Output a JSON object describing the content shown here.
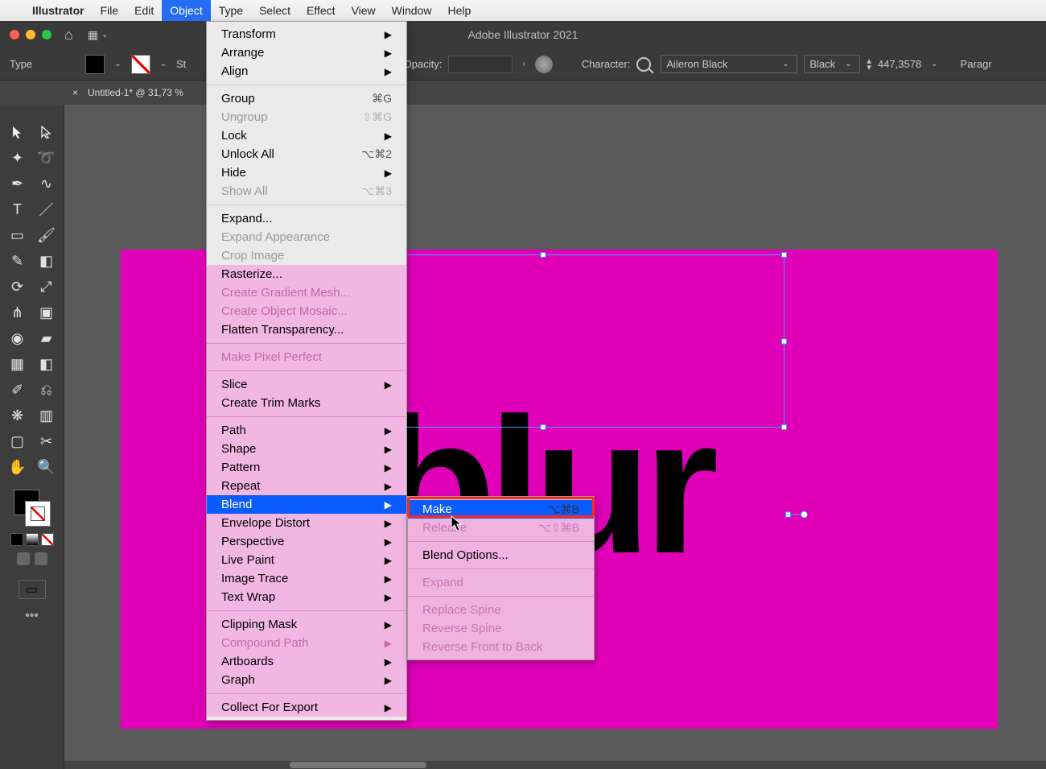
{
  "mac_menu": {
    "apple": "",
    "app": "Illustrator",
    "items": [
      "File",
      "Edit",
      "Object",
      "Type",
      "Select",
      "Effect",
      "View",
      "Window",
      "Help"
    ],
    "active": "Object"
  },
  "app": {
    "title": "Adobe Illustrator 2021"
  },
  "options_bar": {
    "type_label": "Type",
    "stroke_label": "St",
    "opacity_label": "Opacity:",
    "character_label": "Character:",
    "font_family": "Aileron Black",
    "font_style": "Black",
    "font_size": "447,3578",
    "right_label": "Paragr"
  },
  "document": {
    "tab": "Untitled-1* @ 31,73 %",
    "close": "×"
  },
  "canvas": {
    "text": "blur"
  },
  "object_menu_top": [
    {
      "label": "Transform",
      "arrow": true
    },
    {
      "label": "Arrange",
      "arrow": true
    },
    {
      "label": "Align",
      "arrow": true
    },
    {
      "sep": true
    },
    {
      "label": "Group",
      "shortcut": "⌘G"
    },
    {
      "label": "Ungroup",
      "shortcut": "⇧⌘G",
      "disabled": true
    },
    {
      "label": "Lock",
      "arrow": true
    },
    {
      "label": "Unlock All",
      "shortcut": "⌥⌘2"
    },
    {
      "label": "Hide",
      "arrow": true
    },
    {
      "label": "Show All",
      "shortcut": "⌥⌘3",
      "disabled": true
    },
    {
      "sep": true
    },
    {
      "label": "Expand..."
    },
    {
      "label": "Expand Appearance",
      "disabled": true
    },
    {
      "label": "Crop Image",
      "disabled": true
    }
  ],
  "object_menu_bottom": [
    {
      "label": "Rasterize..."
    },
    {
      "label": "Create Gradient Mesh...",
      "disabled": true
    },
    {
      "label": "Create Object Mosaic...",
      "disabled": true
    },
    {
      "label": "Flatten Transparency..."
    },
    {
      "sep": true
    },
    {
      "label": "Make Pixel Perfect",
      "disabled": true
    },
    {
      "sep": true
    },
    {
      "label": "Slice",
      "arrow": true
    },
    {
      "label": "Create Trim Marks"
    },
    {
      "sep": true
    },
    {
      "label": "Path",
      "arrow": true
    },
    {
      "label": "Shape",
      "arrow": true
    },
    {
      "label": "Pattern",
      "arrow": true
    },
    {
      "label": "Repeat",
      "arrow": true
    },
    {
      "label": "Blend",
      "arrow": true,
      "highlight": true
    },
    {
      "label": "Envelope Distort",
      "arrow": true
    },
    {
      "label": "Perspective",
      "arrow": true
    },
    {
      "label": "Live Paint",
      "arrow": true
    },
    {
      "label": "Image Trace",
      "arrow": true
    },
    {
      "label": "Text Wrap",
      "arrow": true
    },
    {
      "sep": true
    },
    {
      "label": "Clipping Mask",
      "arrow": true
    },
    {
      "label": "Compound Path",
      "arrow": true,
      "disabled": true
    },
    {
      "label": "Artboards",
      "arrow": true
    },
    {
      "label": "Graph",
      "arrow": true
    },
    {
      "sep": true
    },
    {
      "label": "Collect For Export",
      "arrow": true
    }
  ],
  "blend_submenu": [
    {
      "label": "Make",
      "shortcut": "⌥⌘B",
      "highlight": true
    },
    {
      "label": "Release",
      "shortcut": "⌥⇧⌘B",
      "disabled": true
    },
    {
      "sep": true
    },
    {
      "label": "Blend Options..."
    },
    {
      "sep": true
    },
    {
      "label": "Expand",
      "disabled": true
    },
    {
      "sep": true
    },
    {
      "label": "Replace Spine",
      "disabled": true
    },
    {
      "label": "Reverse Spine",
      "disabled": true
    },
    {
      "label": "Reverse Front to Back",
      "disabled": true
    }
  ],
  "tool_icons": [
    "selection",
    "direct-selection",
    "pen",
    "curvature",
    "pen-add",
    "pencil",
    "type",
    "line",
    "rectangle",
    "paintbrush",
    "shape-builder",
    "eraser",
    "rotate",
    "scale",
    "width",
    "free-transform",
    "perspective",
    "mesh",
    "gradient",
    "eyedropper",
    "blend",
    "symbol",
    "column-graph",
    "artboard",
    "slice",
    "hand",
    "zoom"
  ]
}
